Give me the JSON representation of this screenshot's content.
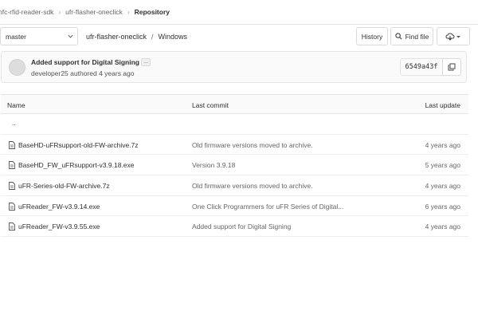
{
  "breadcrumb": {
    "items": [
      "nfc-rfid-reader-sdk",
      "ufr-flasher-oneclick",
      "Repository"
    ]
  },
  "toolbar": {
    "branch": "master",
    "path": [
      "ufr-flasher-oneclick",
      "Windows"
    ],
    "path_sep": "/",
    "history_label": "History",
    "find_file_label": "Find file"
  },
  "commit": {
    "title": "Added support for Digital Signing",
    "ellipsis": "...",
    "meta": "developer25 authored 4 years ago",
    "sha": "6549a43f"
  },
  "table": {
    "headers": {
      "name": "Name",
      "last_commit": "Last commit",
      "last_update": "Last update"
    },
    "parent": "..",
    "rows": [
      {
        "name": "BaseHD-uFRsupport-old-FW-archive.7z",
        "message": "Old firmware versions moved to archive.",
        "updated": "4 years ago"
      },
      {
        "name": "BaseHD_FW_uFRsupport-v3.9.18.exe",
        "message": "Version 3.9.18",
        "updated": "5 years ago"
      },
      {
        "name": "uFR-Series-old-FW-archive.7z",
        "message": "Old firmware versions moved to archive.",
        "updated": "4 years ago"
      },
      {
        "name": "uFReader_FW-v3.9.14.exe",
        "message": "One Click Programmers for uFR Series of Digital...",
        "updated": "6 years ago"
      },
      {
        "name": "uFReader_FW-v3.9.55.exe",
        "message": "Added support for Digital Signing",
        "updated": "4 years ago"
      }
    ]
  },
  "icons": {
    "breadcrumb_separator": "chevron-right-icon",
    "branch_dropdown": "chevron-down-icon",
    "find_file": "search-icon",
    "more": "cloud-download-icon",
    "copy_sha": "copy-icon",
    "file": "file-icon"
  }
}
